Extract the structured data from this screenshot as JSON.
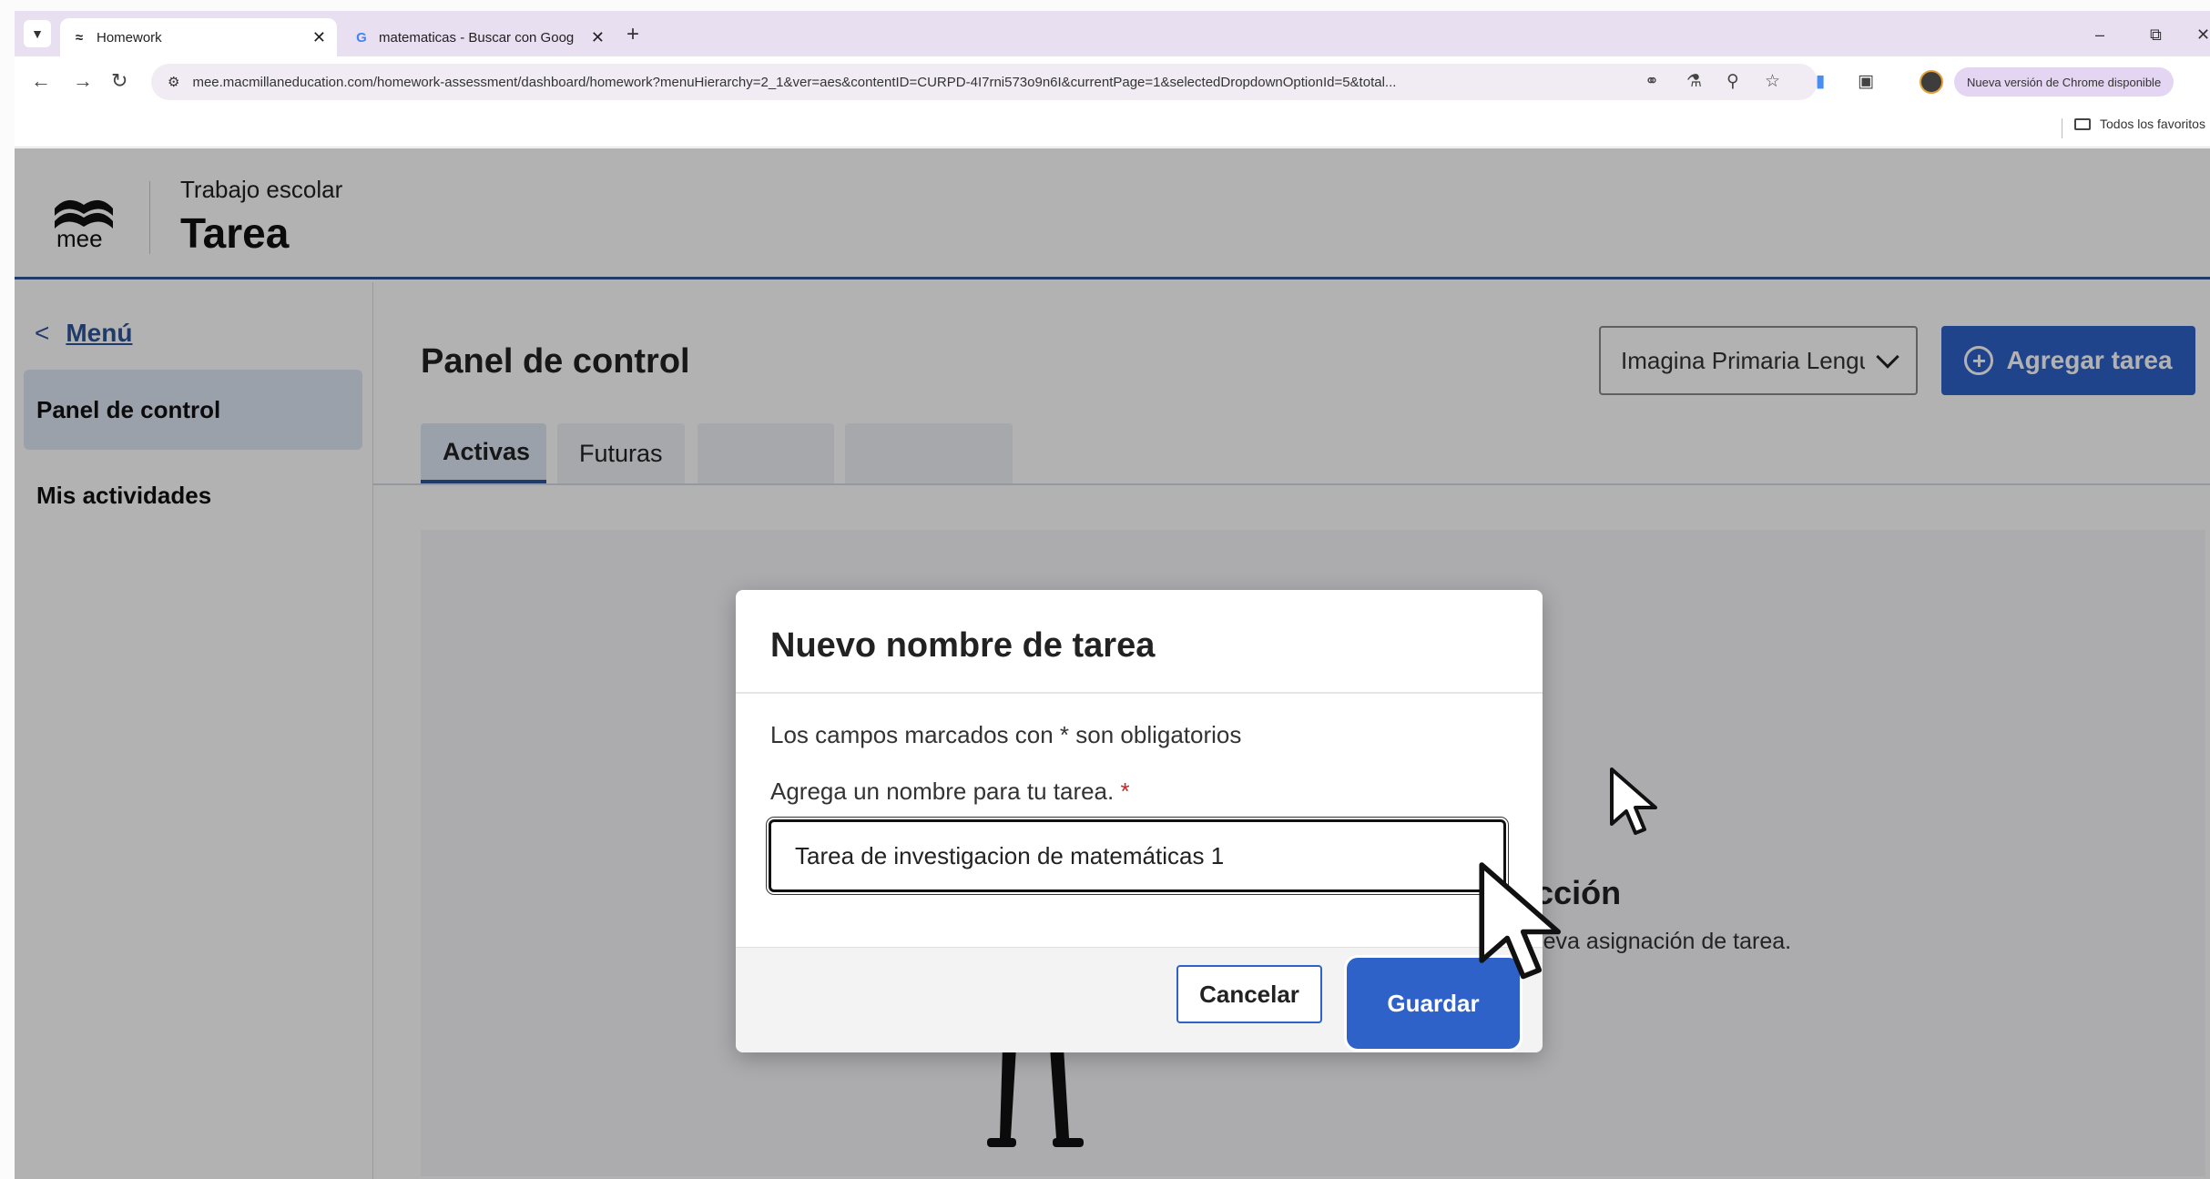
{
  "browser": {
    "tabs": [
      {
        "title": "Homework",
        "active": true,
        "favicon": "macmillan-icon"
      },
      {
        "title": "matematicas - Buscar con Goog",
        "active": false,
        "favicon": "google-icon"
      }
    ],
    "url": "mee.macmillaneducation.com/homework-assessment/dashboard/homework?menuHierarchy=2_1&ver=aes&contentID=CURPD-4I7rni573o9n6I&currentPage=1&selectedDropdownOptionId=5&total...",
    "update_notice": "Nueva versión de Chrome disponible",
    "bookmarks_all": "Todos los favoritos"
  },
  "header": {
    "logo_text": "mee",
    "subtitle": "Trabajo escolar",
    "title": "Tarea"
  },
  "sidebar": {
    "menu_label": "Menú",
    "items": [
      {
        "label": "Panel de control",
        "selected": true
      },
      {
        "label": "Mis actividades",
        "selected": false
      }
    ]
  },
  "main": {
    "title": "Panel de control",
    "dropdown_value": "Imagina Primaria Lengua",
    "add_button": "Agregar tarea",
    "tabs": [
      "Activas",
      "Futuras",
      "",
      ""
    ],
    "empty_title_fragment": "sección",
    "empty_desc_fragment": "a nueva asignación de tarea."
  },
  "modal": {
    "title": "Nuevo nombre de tarea",
    "required_note": "Los campos marcados con * son obligatorios",
    "field_label": "Agrega un nombre para tu tarea.",
    "required_mark": "*",
    "input_value": "Tarea de investigacion de matemáticas 1",
    "cancel_label": "Cancelar",
    "save_label": "Guardar"
  },
  "colors": {
    "primary": "#2f62c9",
    "header_border": "#2f5597",
    "tab_strip": "#e8dff1"
  }
}
